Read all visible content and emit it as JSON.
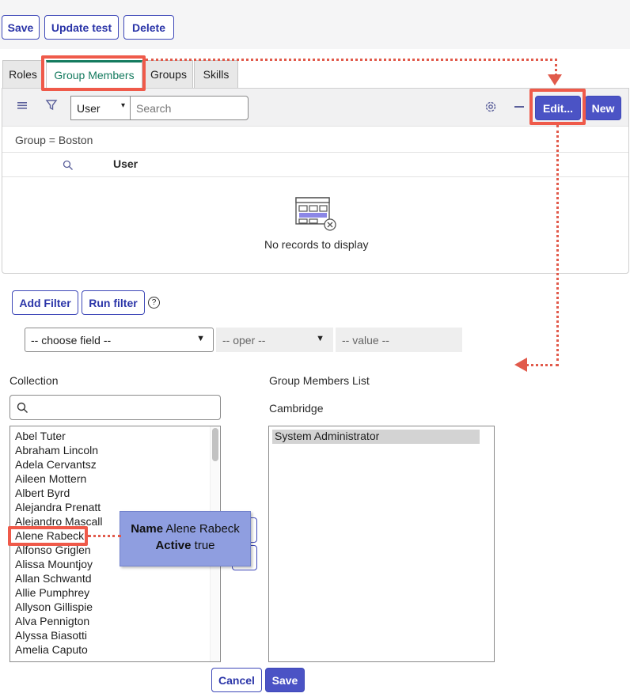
{
  "toolbar": {
    "save_label": "Save",
    "update_label": "Update test",
    "delete_label": "Delete"
  },
  "tabs": [
    {
      "label": "Roles"
    },
    {
      "label": "Group Members"
    },
    {
      "label": "Groups"
    },
    {
      "label": "Skills"
    }
  ],
  "list_toolbar": {
    "field_select": "User",
    "search_placeholder": "Search",
    "edit_label": "Edit...",
    "new_label": "New"
  },
  "breadcrumb": "Group = Boston",
  "table": {
    "column_user": "User",
    "empty_message": "No records to display"
  },
  "filter": {
    "add_filter_label": "Add Filter",
    "run_filter_label": "Run filter",
    "help_glyph": "?",
    "choose_field": "-- choose field --",
    "oper": "-- oper --",
    "value": "-- value --"
  },
  "collection": {
    "title": "Collection",
    "items": [
      "Abel Tuter",
      "Abraham Lincoln",
      "Adela Cervantsz",
      "Aileen Mottern",
      "Albert Byrd",
      "Alejandra Prenatt",
      "Alejandro Mascall",
      "Alene Rabeck",
      "Alfonso Griglen",
      "Alissa Mountjoy",
      "Allan Schwantd",
      "Allie Pumphrey",
      "Allyson Gillispie",
      "Alva Pennigton",
      "Alyssa Biasotti",
      "Amelia Caputo"
    ]
  },
  "group_members": {
    "title": "Group Members List",
    "group_name": "Cambridge",
    "items": [
      "System Administrator"
    ]
  },
  "tooltip": {
    "name_key": "Name",
    "name_value": "Alene Rabeck",
    "active_key": "Active",
    "active_value": "true"
  },
  "footer": {
    "cancel_label": "Cancel",
    "save_label": "Save"
  },
  "colors": {
    "accent": "#4b53c5",
    "highlight": "#ef5a4a",
    "active_tab": "#137a5e",
    "tooltip_bg": "#8f9ee0"
  }
}
